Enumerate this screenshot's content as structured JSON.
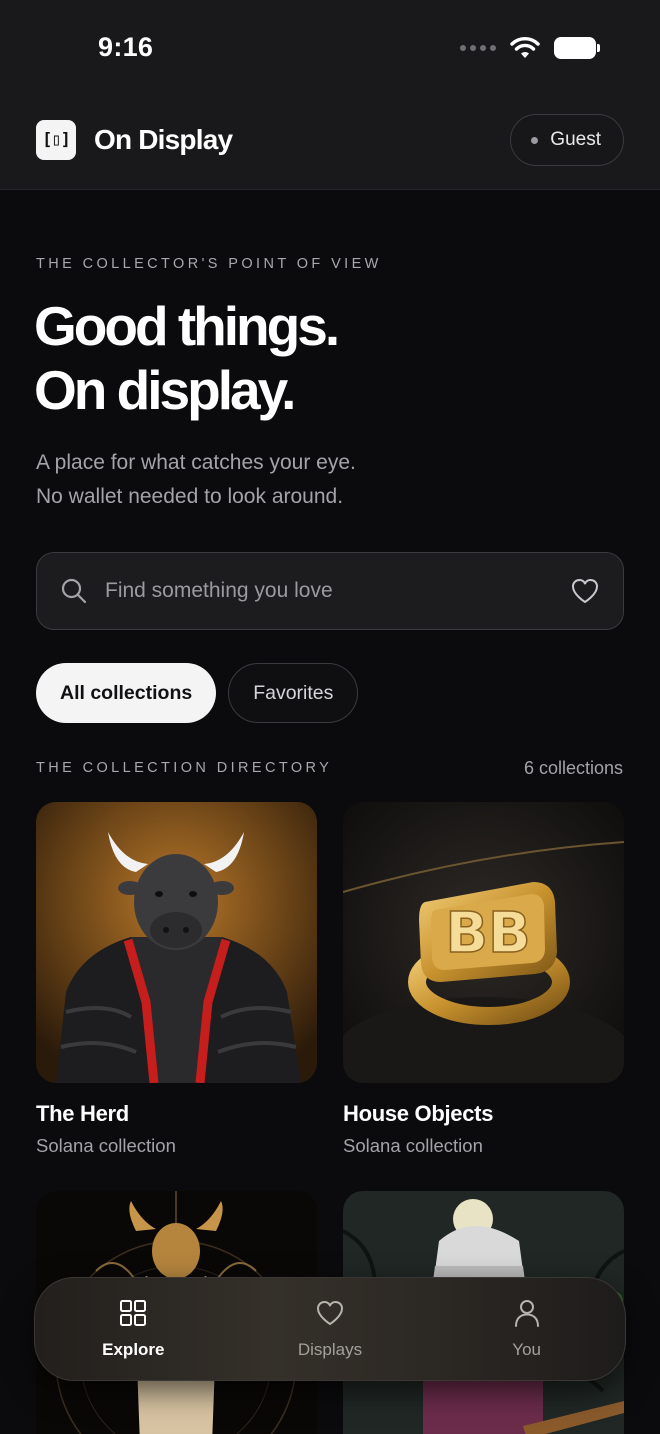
{
  "status_bar": {
    "time": "9:16"
  },
  "header": {
    "logo_glyph": "[▯]",
    "brand_name": "On Display",
    "guest_label": "Guest"
  },
  "hero": {
    "eyebrow": "THE COLLECTOR'S POINT OF VIEW",
    "headline_line1": "Good things.",
    "headline_line2": "On display.",
    "sub_line1": "A place for what catches your eye.",
    "sub_line2": "No wallet needed to look around."
  },
  "search": {
    "placeholder": "Find something you love",
    "value": ""
  },
  "chips": [
    {
      "label": "All collections",
      "active": true
    },
    {
      "label": "Favorites",
      "active": false
    }
  ],
  "directory": {
    "label": "THE COLLECTION DIRECTORY",
    "count": "6 collections"
  },
  "collections": [
    {
      "title": "The Herd",
      "subtitle": "Solana collection",
      "image": "bull-in-puffer-jacket"
    },
    {
      "title": "House Objects",
      "subtitle": "Solana collection",
      "image": "gold-bb-signet-ring"
    },
    {
      "title": "",
      "subtitle": "",
      "image": "golden-bull-idol"
    },
    {
      "title": "",
      "subtitle": "",
      "image": "skeleton-in-beanie"
    }
  ],
  "tabbar": [
    {
      "label": "Explore",
      "icon": "grid-icon",
      "active": true
    },
    {
      "label": "Displays",
      "icon": "heart-icon",
      "active": false
    },
    {
      "label": "You",
      "icon": "person-icon",
      "active": false
    }
  ],
  "colors": {
    "background": "#0b0b0d",
    "topband": "#19191b",
    "chip_active": "#f4f4f5",
    "muted_text": "#a3a3a8"
  }
}
